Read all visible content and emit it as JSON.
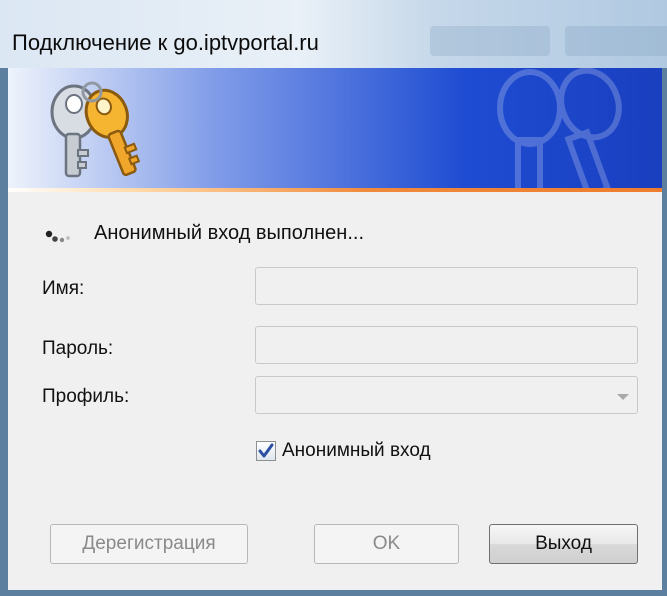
{
  "window": {
    "title": "Подключение к go.iptvportal.ru"
  },
  "banner": {
    "keys_icon": "keys-icon",
    "watermark_icon": "keys-watermark-icon"
  },
  "status": {
    "icon": "loading-dots-icon",
    "text": "Анонимный вход выполнен..."
  },
  "form": {
    "name_label": "Имя:",
    "name_value": "",
    "password_label": "Пароль:",
    "password_value": "",
    "profile_label": "Профиль:",
    "profile_value": "",
    "anonymous_label": "Анонимный вход",
    "anonymous_checked": true
  },
  "buttons": {
    "deregister": "Дерегистрация",
    "ok": "OK",
    "exit": "Выход"
  }
}
